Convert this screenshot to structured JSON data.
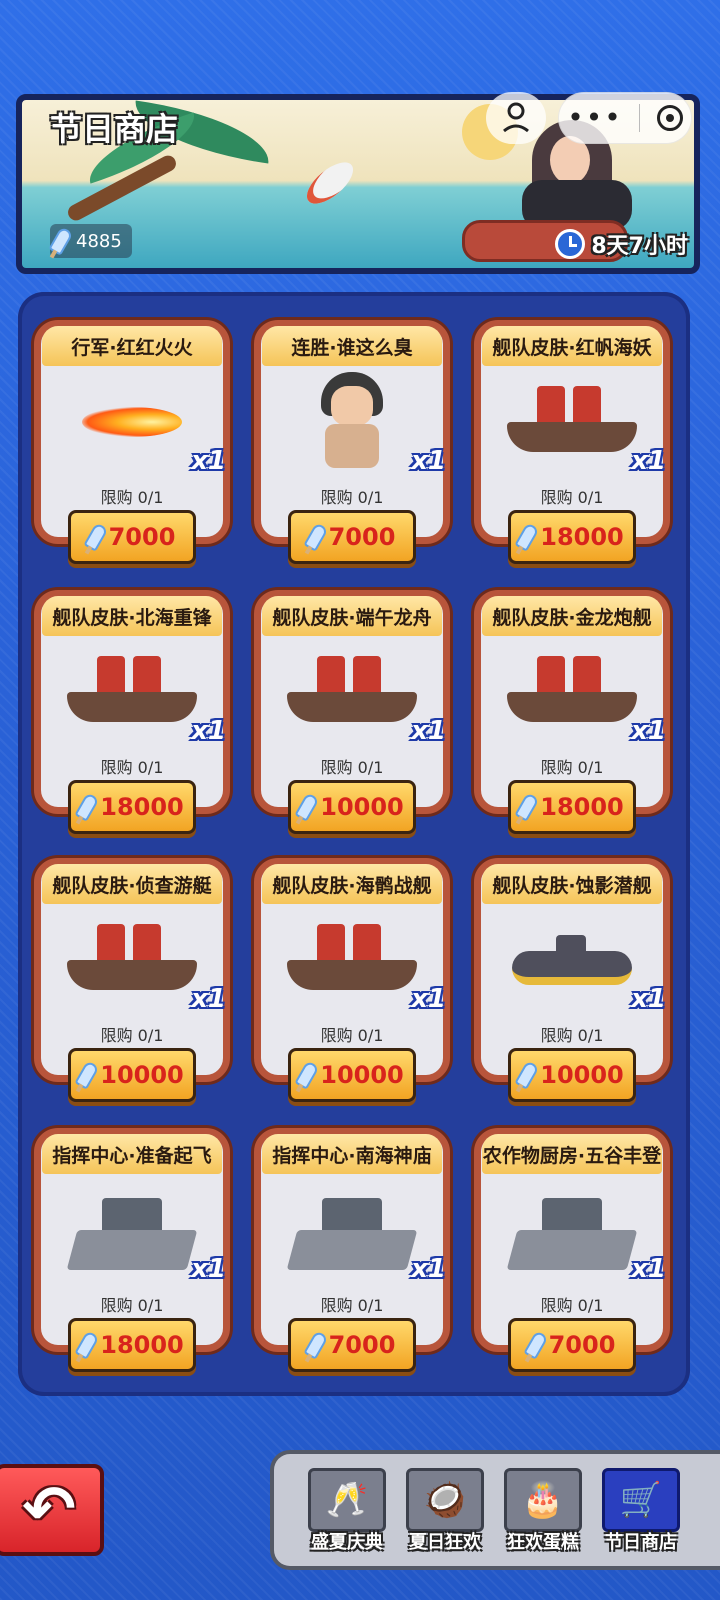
{
  "header": {
    "title": "节日商店",
    "currency_amount": "4885",
    "timer": "8天7小时"
  },
  "shop": {
    "items": [
      {
        "name": "行军·红红火火",
        "limit": "限购 0/1",
        "qty": "x1",
        "price": "7000",
        "art": "fire-trail"
      },
      {
        "name": "连胜·谁这么臭",
        "limit": "限购 0/1",
        "qty": "x1",
        "price": "7000",
        "art": "smelly-man"
      },
      {
        "name": "舰队皮肤·红帆海妖",
        "limit": "限购 0/1",
        "qty": "x1",
        "price": "18000",
        "art": "red-sail-ship"
      },
      {
        "name": "舰队皮肤·北海重锋",
        "limit": "限购 0/1",
        "qty": "x1",
        "price": "18000",
        "art": "armored-ship"
      },
      {
        "name": "舰队皮肤·端午龙舟",
        "limit": "限购 0/1",
        "qty": "x1",
        "price": "10000",
        "art": "dragon-boat"
      },
      {
        "name": "舰队皮肤·金龙炮舰",
        "limit": "限购 0/1",
        "qty": "x1",
        "price": "18000",
        "art": "golden-dragon-ship"
      },
      {
        "name": "舰队皮肤·侦查游艇",
        "limit": "限购 0/1",
        "qty": "x1",
        "price": "10000",
        "art": "scout-yacht"
      },
      {
        "name": "舰队皮肤·海鹘战舰",
        "limit": "限购 0/1",
        "qty": "x1",
        "price": "10000",
        "art": "seahawk-warship"
      },
      {
        "name": "舰队皮肤·蚀影潜舰",
        "limit": "限购 0/1",
        "qty": "x1",
        "price": "10000",
        "art": "submarine"
      },
      {
        "name": "指挥中心·准备起飞",
        "limit": "限购 0/1",
        "qty": "x1",
        "price": "18000",
        "art": "airbase"
      },
      {
        "name": "指挥中心·南海神庙",
        "limit": "限购 0/1",
        "qty": "x1",
        "price": "7000",
        "art": "temple"
      },
      {
        "name": "农作物厨房·五谷丰登",
        "limit": "限购 0/1",
        "qty": "x1",
        "price": "7000",
        "art": "kitchen"
      }
    ]
  },
  "tabs": [
    {
      "label": "盛夏庆典",
      "icon": "cheers-glasses-icon"
    },
    {
      "label": "夏日狂欢",
      "icon": "coconut-drink-icon"
    },
    {
      "label": "狂欢蛋糕",
      "icon": "cake-icon"
    },
    {
      "label": "节日商店",
      "icon": "shopping-cart-icon",
      "active": true
    }
  ],
  "colors": {
    "background": "#2a62d8",
    "panel": "#243e9c",
    "card_border": "#b8553b",
    "price_text": "#d8241c",
    "buy_button": "#f2a423",
    "back_button": "#d8242a"
  }
}
